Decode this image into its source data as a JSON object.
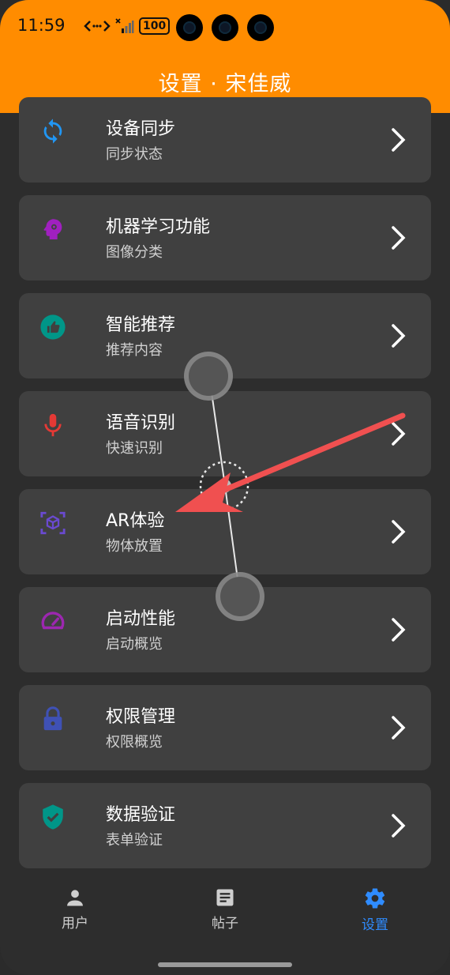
{
  "status_bar": {
    "time": "11:59",
    "battery": "100"
  },
  "header": {
    "title": "设置 · 宋佳威"
  },
  "settings_items": [
    {
      "title": "设备同步",
      "subtitle": "同步状态",
      "icon": "sync-icon",
      "color": "#2196f3"
    },
    {
      "title": "机器学习功能",
      "subtitle": "图像分类",
      "icon": "brain-icon",
      "color": "#a020c0"
    },
    {
      "title": "智能推荐",
      "subtitle": "推荐内容",
      "icon": "thumb-up-icon",
      "color": "#009688"
    },
    {
      "title": "语音识别",
      "subtitle": "快速识别",
      "icon": "mic-icon",
      "color": "#e53935"
    },
    {
      "title": "AR体验",
      "subtitle": "物体放置",
      "icon": "ar-cube-icon",
      "color": "#6a4ad0"
    },
    {
      "title": "启动性能",
      "subtitle": "启动概览",
      "icon": "speedometer-icon",
      "color": "#9c27b0"
    },
    {
      "title": "权限管理",
      "subtitle": "权限概览",
      "icon": "lock-icon",
      "color": "#3f51b5"
    },
    {
      "title": "数据验证",
      "subtitle": "表单验证",
      "icon": "shield-check-icon",
      "color": "#009688"
    }
  ],
  "bottom_nav": [
    {
      "label": "用户",
      "icon": "person-icon",
      "active": false
    },
    {
      "label": "帖子",
      "icon": "article-icon",
      "active": false
    },
    {
      "label": "设置",
      "icon": "gear-icon",
      "active": true
    }
  ],
  "colors": {
    "accent": "#ff8c00",
    "nav_active": "#2f8cff",
    "card": "#404040",
    "background": "#2d2d2d"
  }
}
